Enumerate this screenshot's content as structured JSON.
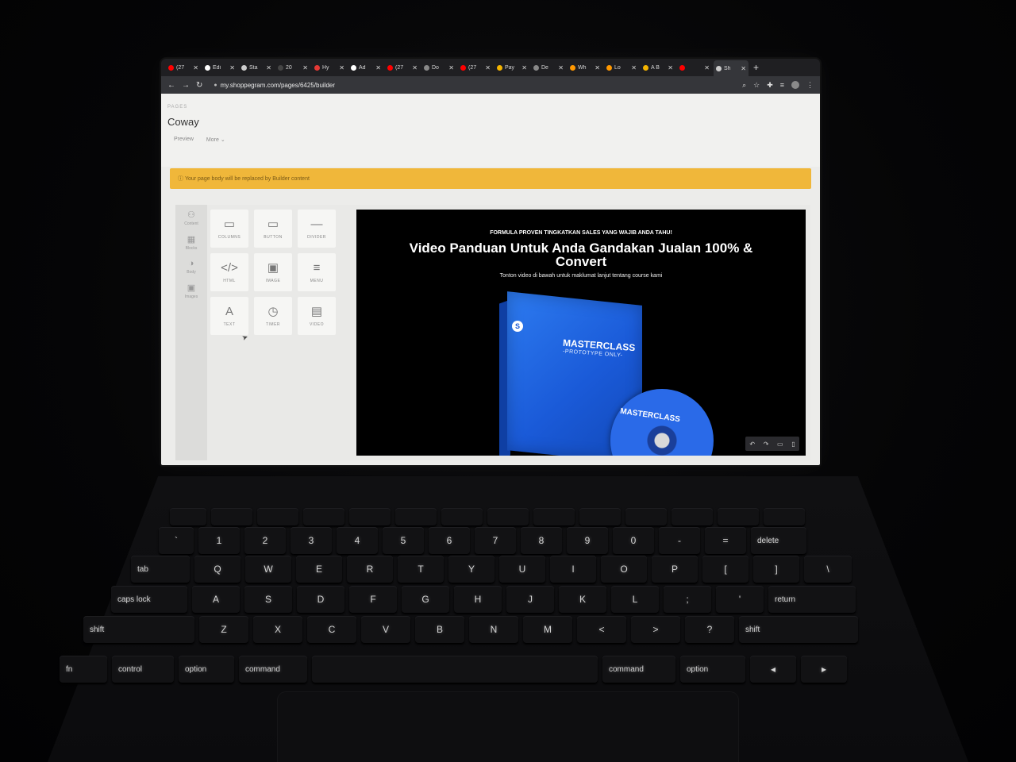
{
  "browser": {
    "tabs": [
      {
        "title": "(27",
        "color": "#ff0000"
      },
      {
        "title": "Edi",
        "color": "#ffffff"
      },
      {
        "title": "Sta",
        "color": "#cccccc"
      },
      {
        "title": "20",
        "color": "#444444"
      },
      {
        "title": "Hy",
        "color": "#e53935"
      },
      {
        "title": "Ad",
        "color": "#ffffff"
      },
      {
        "title": "(27",
        "color": "#ff0000"
      },
      {
        "title": "Do",
        "color": "#888888"
      },
      {
        "title": "(27",
        "color": "#ff0000"
      },
      {
        "title": "Pay",
        "color": "#f4b400"
      },
      {
        "title": "De",
        "color": "#888888"
      },
      {
        "title": "Wh",
        "color": "#ff9800"
      },
      {
        "title": "Lo",
        "color": "#ff9800"
      },
      {
        "title": "A B",
        "color": "#f4b400"
      },
      {
        "title": "",
        "color": "#ff0000"
      },
      {
        "title": "Sh",
        "color": "#cccccc"
      }
    ],
    "url": "my.shoppegram.com/pages/6425/builder"
  },
  "page": {
    "crumb": "PAGES",
    "title": "Coway",
    "links": [
      "Preview",
      "More"
    ],
    "banner": "Your page body will be replaced by Builder content"
  },
  "rail": [
    {
      "label": "Content",
      "icon": "shapes-icon"
    },
    {
      "label": "Blocks",
      "icon": "grid-icon"
    },
    {
      "label": "Body",
      "icon": "palette-icon"
    },
    {
      "label": "Images",
      "icon": "image-icon"
    }
  ],
  "tools": [
    {
      "label": "COLUMNS",
      "glyph": "▭",
      "icon": "columns-icon"
    },
    {
      "label": "BUTTON",
      "glyph": "▭",
      "icon": "button-icon"
    },
    {
      "label": "DIVIDER",
      "glyph": "—",
      "icon": "divider-icon"
    },
    {
      "label": "HTML",
      "glyph": "</>",
      "icon": "code-icon"
    },
    {
      "label": "IMAGE",
      "glyph": "▣",
      "icon": "image-icon"
    },
    {
      "label": "MENU",
      "glyph": "≡",
      "icon": "menu-icon"
    },
    {
      "label": "TEXT",
      "glyph": "A",
      "icon": "text-icon"
    },
    {
      "label": "TIMER",
      "glyph": "◷",
      "icon": "clock-icon"
    },
    {
      "label": "VIDEO",
      "glyph": "▤",
      "icon": "film-icon"
    }
  ],
  "canvas": {
    "kicker": "FORMULA PROVEN TINGKATKAN SALES YANG WAJIB ANDA TAHU!",
    "headline": "Video Panduan Untuk Anda Gandakan Jualan 100% & Convert",
    "sub": "Tonton video di bawah untuk maklumat lanjut tentang course kami",
    "box_title": "MASTERCLASS",
    "box_sub": "-PROTOTYPE ONLY-",
    "box_logo": "S",
    "disc_label": "MASTERCLASS"
  },
  "keyboard": {
    "row_numbers": [
      "`",
      "1",
      "2",
      "3",
      "4",
      "5",
      "6",
      "7",
      "8",
      "9",
      "0",
      "-",
      "=",
      "delete"
    ],
    "row_top": [
      "tab",
      "Q",
      "W",
      "E",
      "R",
      "T",
      "Y",
      "U",
      "I",
      "O",
      "P",
      "[",
      "]",
      "\\"
    ],
    "row_home": [
      "caps lock",
      "A",
      "S",
      "D",
      "F",
      "G",
      "H",
      "J",
      "K",
      "L",
      ";",
      "'",
      "return"
    ],
    "row_bottom": [
      "shift",
      "Z",
      "X",
      "C",
      "V",
      "B",
      "N",
      "M",
      "<",
      ">",
      "?",
      "shift"
    ],
    "row_mod": [
      "fn",
      "control",
      "option",
      "command",
      "",
      "command",
      "option",
      "◂",
      "▸"
    ]
  }
}
